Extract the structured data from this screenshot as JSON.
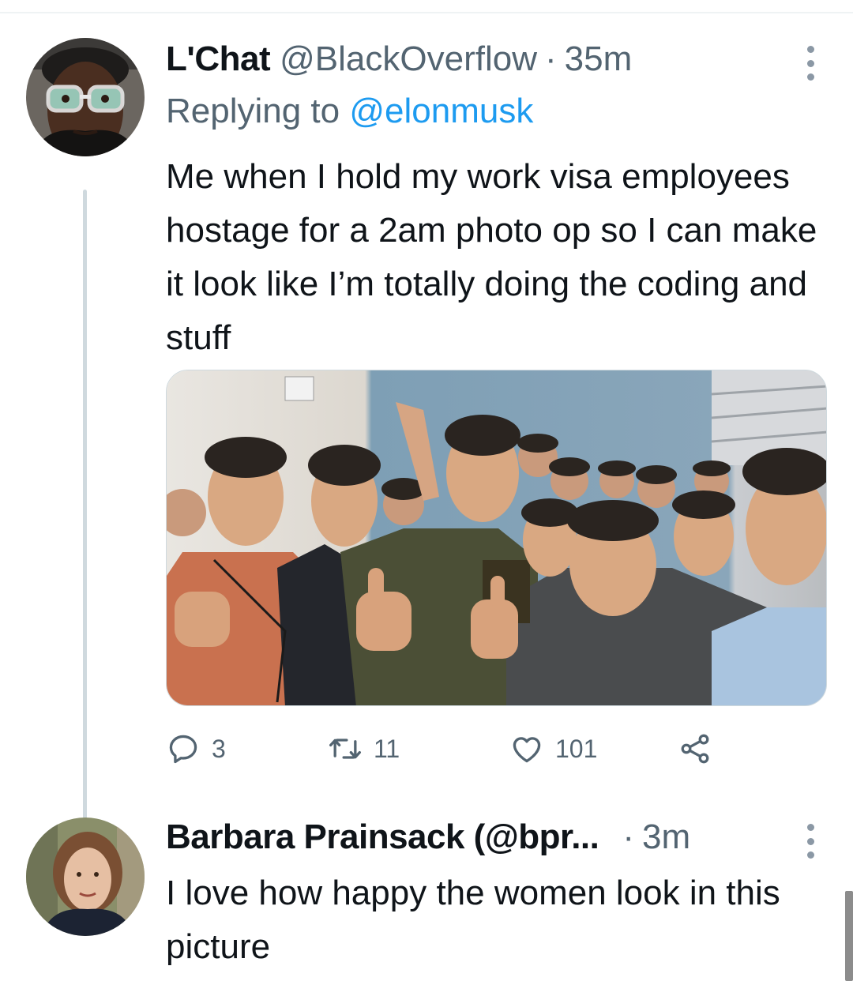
{
  "tweets": [
    {
      "display_name": "L'Chat",
      "handle": "@BlackOverflow",
      "separator": "·",
      "time": "35m",
      "replying_prefix": "Replying to",
      "replying_to": "@elonmusk",
      "text": "Me when I hold my work visa employees hostage for a 2am photo op so I can make it look like I’m totally doing the coding and stuff",
      "avatar_icon": "person-with-glasses-avatar",
      "media": "group-photo",
      "actions": {
        "reply_count": "3",
        "retweet_count": "11",
        "like_count": "101"
      }
    },
    {
      "display_name": "Barbara Prainsack (@bpr...",
      "separator": "·",
      "time": "3m",
      "text": "I love how happy the women look in this picture",
      "avatar_icon": "woman-portrait-avatar"
    }
  ],
  "colors": {
    "text_primary": "#0f1419",
    "text_secondary": "#536471",
    "link": "#1d9bf0",
    "thread_line": "#cfd9de"
  }
}
